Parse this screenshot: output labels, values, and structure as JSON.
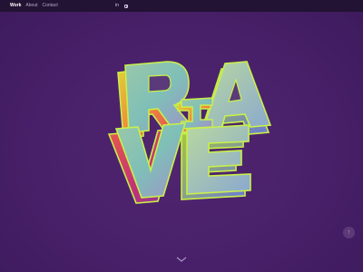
{
  "nav": {
    "links": [
      {
        "label": "Work",
        "active": true
      },
      {
        "label": "About",
        "active": false
      },
      {
        "label": "Contact",
        "active": false
      }
    ],
    "social": {
      "linkedin_label": "in",
      "instagram_icon": "instagram-icon"
    }
  },
  "artwork": {
    "letters": [
      "R",
      "A",
      "I",
      "V",
      "E"
    ]
  },
  "controls": {
    "scroll_down_icon": "chevron-down-icon",
    "back_to_top_glyph": "↑"
  },
  "colors": {
    "background": "#4a2068",
    "nav_background": "#221233",
    "letter_outline": "#c8f04a",
    "letter_face": "#7fbfa8"
  }
}
